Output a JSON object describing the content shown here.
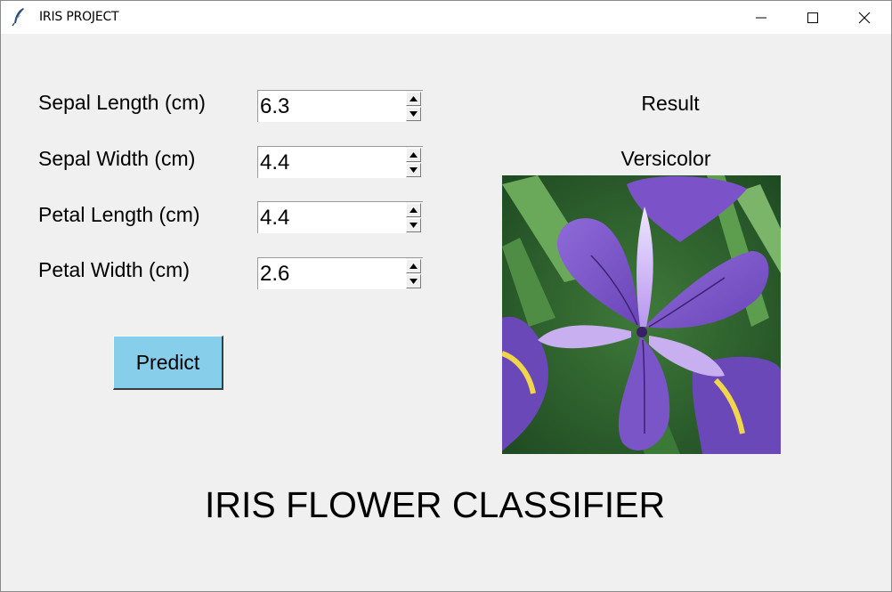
{
  "window": {
    "title": "IRIS PROJECT",
    "icons": {
      "app": "feather-icon",
      "minimize": "minimize-icon",
      "maximize": "maximize-icon",
      "close": "close-icon"
    }
  },
  "form": {
    "fields": [
      {
        "label": "Sepal Length (cm)",
        "value": "6.3"
      },
      {
        "label": "Sepal Width (cm)",
        "value": "4.4"
      },
      {
        "label": "Petal Length (cm)",
        "value": "4.4"
      },
      {
        "label": "Petal Width (cm)",
        "value": "2.6"
      }
    ],
    "predict_label": "Predict",
    "predict_color": "#87ceeb"
  },
  "result": {
    "title": "Result",
    "value": "Versicolor"
  },
  "footer": {
    "title": "IRIS FLOWER CLASSIFIER"
  }
}
